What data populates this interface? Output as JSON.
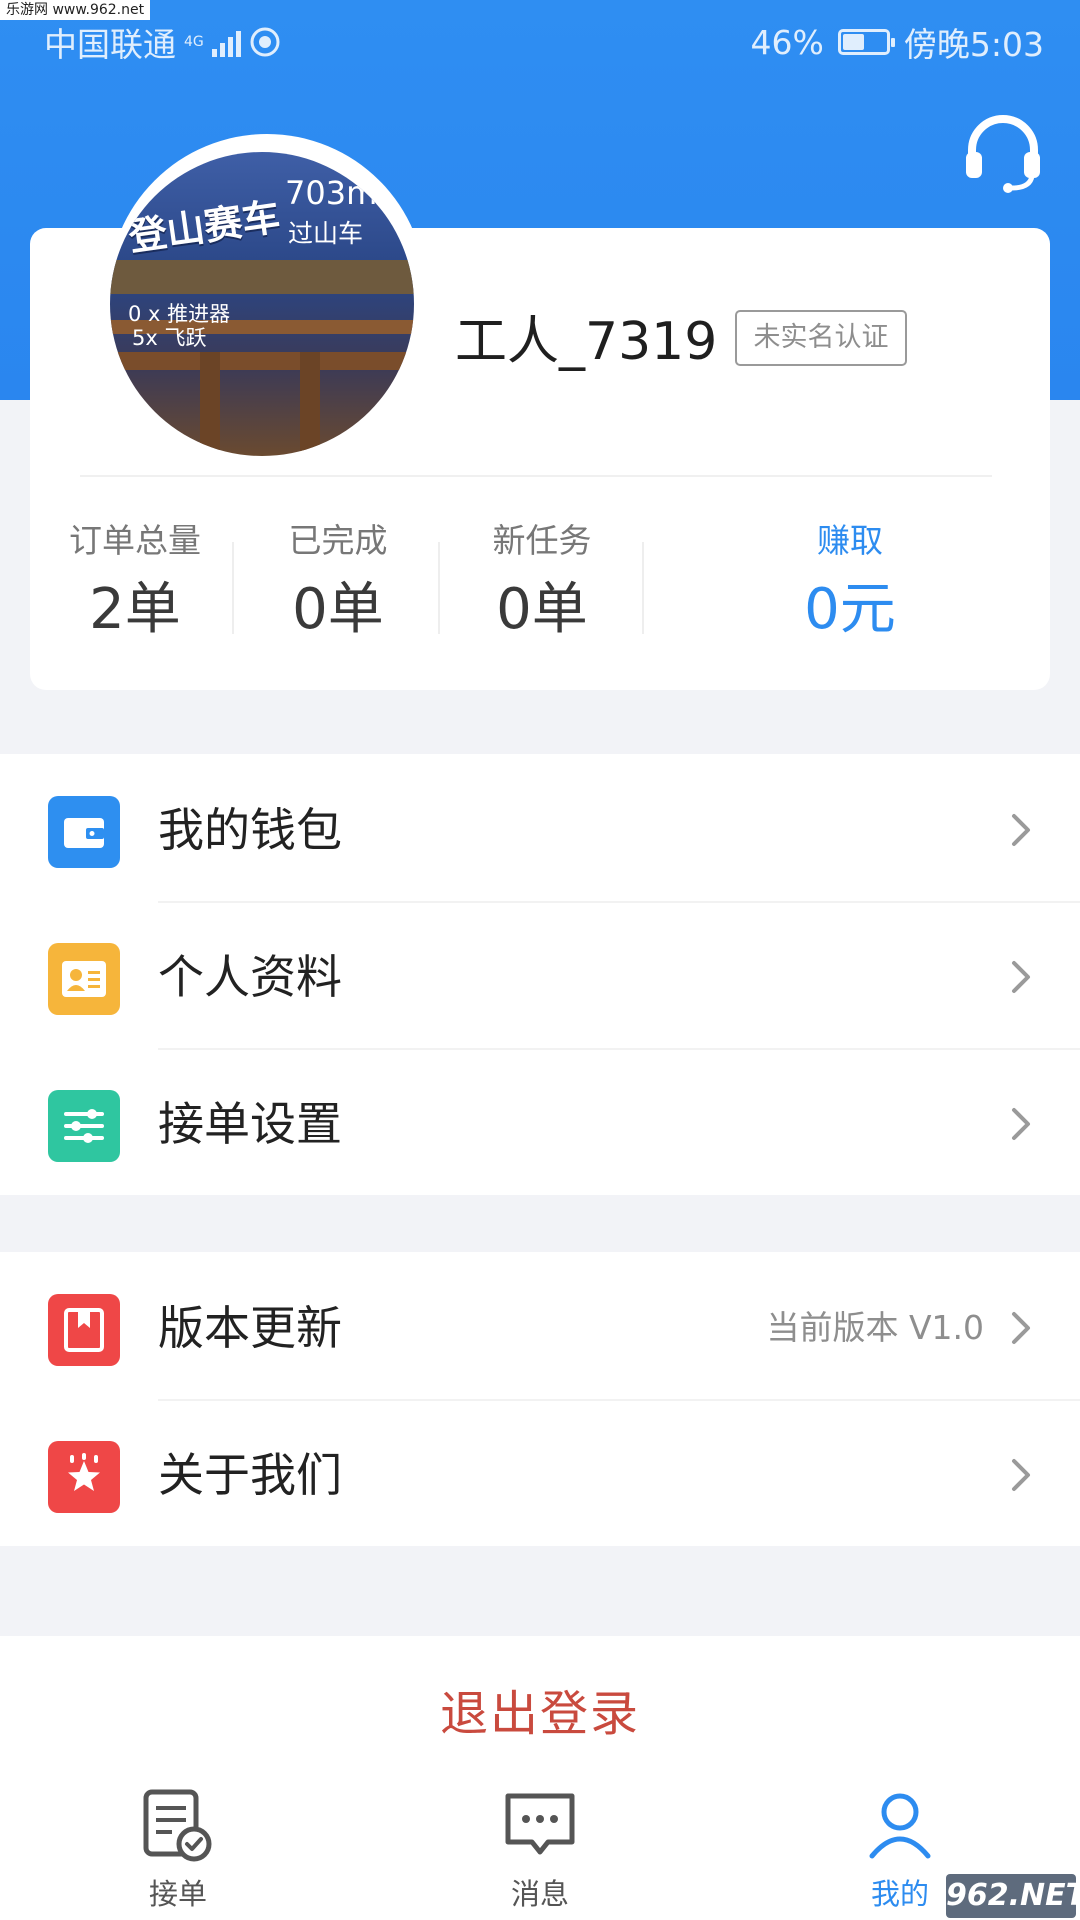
{
  "watermarks": {
    "top_left": "乐游网 www.962.net",
    "bottom_right": "962.NET"
  },
  "status_bar": {
    "carrier": "中国联通",
    "network": "4G",
    "battery": "46%",
    "battery_level": 0.46,
    "time": "傍晚5:03"
  },
  "header": {
    "support_icon": "headset-icon"
  },
  "profile": {
    "avatar_text": {
      "title": "登山赛车",
      "distance": "703m",
      "subtitle": "过山车",
      "line1": "0 x 推进器",
      "line2": "5x 飞跃"
    },
    "username": "工人_7319",
    "verify_status": "未实名认证"
  },
  "stats": [
    {
      "label": "订单总量",
      "value": "2单"
    },
    {
      "label": "已完成",
      "value": "0单"
    },
    {
      "label": "新任务",
      "value": "0单"
    },
    {
      "label": "赚取",
      "value": "0元"
    }
  ],
  "menu_group_1": [
    {
      "label": "我的钱包",
      "icon": "wallet-icon",
      "color": "#2e8ff0"
    },
    {
      "label": "个人资料",
      "icon": "id-card-icon",
      "color": "#f6b53b"
    },
    {
      "label": "接单设置",
      "icon": "sliders-icon",
      "color": "#2fc6a0"
    }
  ],
  "menu_group_2": [
    {
      "label": "版本更新",
      "icon": "bookmark-icon",
      "color": "#ef4747",
      "extra": "当前版本 V1.0"
    },
    {
      "label": "关于我们",
      "icon": "star-icon",
      "color": "#ef4747"
    }
  ],
  "logout": {
    "label": "退出登录",
    "color": "#c94a3e"
  },
  "tabbar": [
    {
      "label": "接单",
      "icon": "order-check-icon",
      "active": false
    },
    {
      "label": "消息",
      "icon": "message-icon",
      "active": false
    },
    {
      "label": "我的",
      "icon": "user-icon",
      "active": true
    }
  ],
  "colors": {
    "primary": "#2d8cf0",
    "background": "#f2f3f7"
  }
}
